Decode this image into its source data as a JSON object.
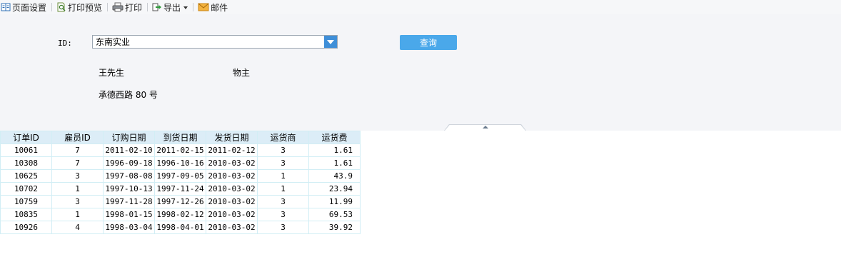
{
  "toolbar": {
    "page_setup": "页面设置",
    "print_preview": "打印预览",
    "print": "打印",
    "export": "导出",
    "mail": "邮件"
  },
  "params": {
    "id_label": "ID:",
    "id_value": "东南实业",
    "query_button": "查询"
  },
  "customer": {
    "contact_name": "王先生",
    "contact_title": "物主",
    "address": "承德西路 80 号"
  },
  "table": {
    "columns": [
      "订单ID",
      "雇员ID",
      "订购日期",
      "到货日期",
      "发货日期",
      "运货商",
      "运货费"
    ],
    "rows": [
      [
        "10061",
        "7",
        "2011-02-10",
        "2011-02-15",
        "2011-02-12",
        "3",
        "1.61"
      ],
      [
        "10308",
        "7",
        "1996-09-18",
        "1996-10-16",
        "2010-03-02",
        "3",
        "1.61"
      ],
      [
        "10625",
        "3",
        "1997-08-08",
        "1997-09-05",
        "2010-03-02",
        "1",
        "43.9"
      ],
      [
        "10702",
        "1",
        "1997-10-13",
        "1997-11-24",
        "2010-03-02",
        "1",
        "23.94"
      ],
      [
        "10759",
        "3",
        "1997-11-28",
        "1997-12-26",
        "2010-03-02",
        "3",
        "11.99"
      ],
      [
        "10835",
        "1",
        "1998-01-15",
        "1998-02-12",
        "2010-03-02",
        "3",
        "69.53"
      ],
      [
        "10926",
        "4",
        "1998-03-04",
        "1998-04-01",
        "2010-03-02",
        "3",
        "39.92"
      ]
    ]
  },
  "colors": {
    "query_button": "#4aa8ea",
    "combo_button": "#3f8fd8",
    "table_header": "#dcedf7",
    "table_border": "#d2eef5",
    "param_background": "#f4f5f8"
  }
}
